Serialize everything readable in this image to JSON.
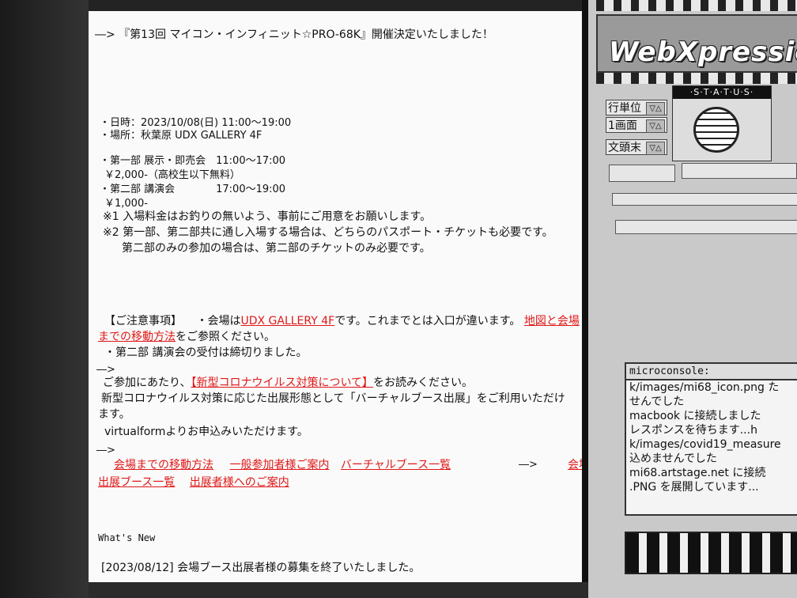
{
  "content": {
    "headline": "―> 『第13回 マイコン・インフィニット☆PRO-68K』開催決定いたしました！",
    "date_line": "・日時：2023/10/08(日) 11:00～19:00",
    "place_line": "・場所：秋葉原 UDX GALLERY 4F",
    "part1": "・第一部 展示・即売会　11:00～17:00",
    "price1": "￥2,000-（高校生以下無料）",
    "part2": "・第二部 講演会　　　　17:00～19:00",
    "price2": "￥1,000-",
    "note1": "※1 入場料金はお釣りの無いよう、事前にご用意をお願いします。",
    "note2a": "※2 第一部、第二部共に通し入場する場合は、どちらのパスポート・チケットも必要です。",
    "note2b": "第二部のみの参加の場合は、第二部のチケットのみ必要です。",
    "caution_label": "【ご注意事項】",
    "caution_text_a": "・会場は",
    "caution_link_venue": "UDX GALLERY 4F",
    "caution_text_b": "です。これまでとは入口が違います。",
    "caution_link_map_a": "地図と会場",
    "caution_link_map_b": "までの移動方法",
    "caution_text_c": "をご参照ください。",
    "caution_closed": "・第二部 講演会の受付は締切りました。",
    "arrow1": "―>",
    "covid_text_a": "ご参加にあたり、",
    "covid_link": "【新型コロナウイルス対策について】",
    "covid_text_b": "をお読みください。",
    "virtual_a": "新型コロナウイルス対策に応じた出展形態として「バーチャルブース出展」をご利用いただけ",
    "virtual_b": "ます。",
    "virtual_c": "virtualformよりお申込みいただけます。",
    "arrow2": "―>",
    "nav_links": [
      "会場までの移動方法",
      "一般参加者様ご案内",
      "バーチャルブース一覧"
    ],
    "arrow3": "―>",
    "nav_link_venue": "会場",
    "nav_links_2": [
      "出展ブース一覧",
      "出展者様へのご案内"
    ],
    "whats_new": "What's New",
    "news_1": "[2023/08/12] 会場ブース出展者様の募集を終了いたしました。"
  },
  "panel": {
    "logo_text": "WebXpressio",
    "buttons": [
      {
        "label": "行単位",
        "arrow": "▽△"
      },
      {
        "label": "1画面",
        "arrow": "▽△"
      },
      {
        "label": "文頭末",
        "arrow": "▽△"
      }
    ],
    "status_title": "·S·T·A·T·U·S·",
    "console_title": "microconsole:",
    "console_lines": [
      "k/images/mi68_icon.png た",
      "せんでした",
      "macbook に接続しました",
      "レスポンスを待ちます...h",
      "k/images/covid19_measure",
      "込めませんでした",
      "mi68.artstage.net に接続",
      ".PNG を展開しています..."
    ]
  },
  "colors": {
    "link": "#e01818",
    "page_bg": "#fafafa",
    "panel_bg": "#c9c9c9"
  }
}
